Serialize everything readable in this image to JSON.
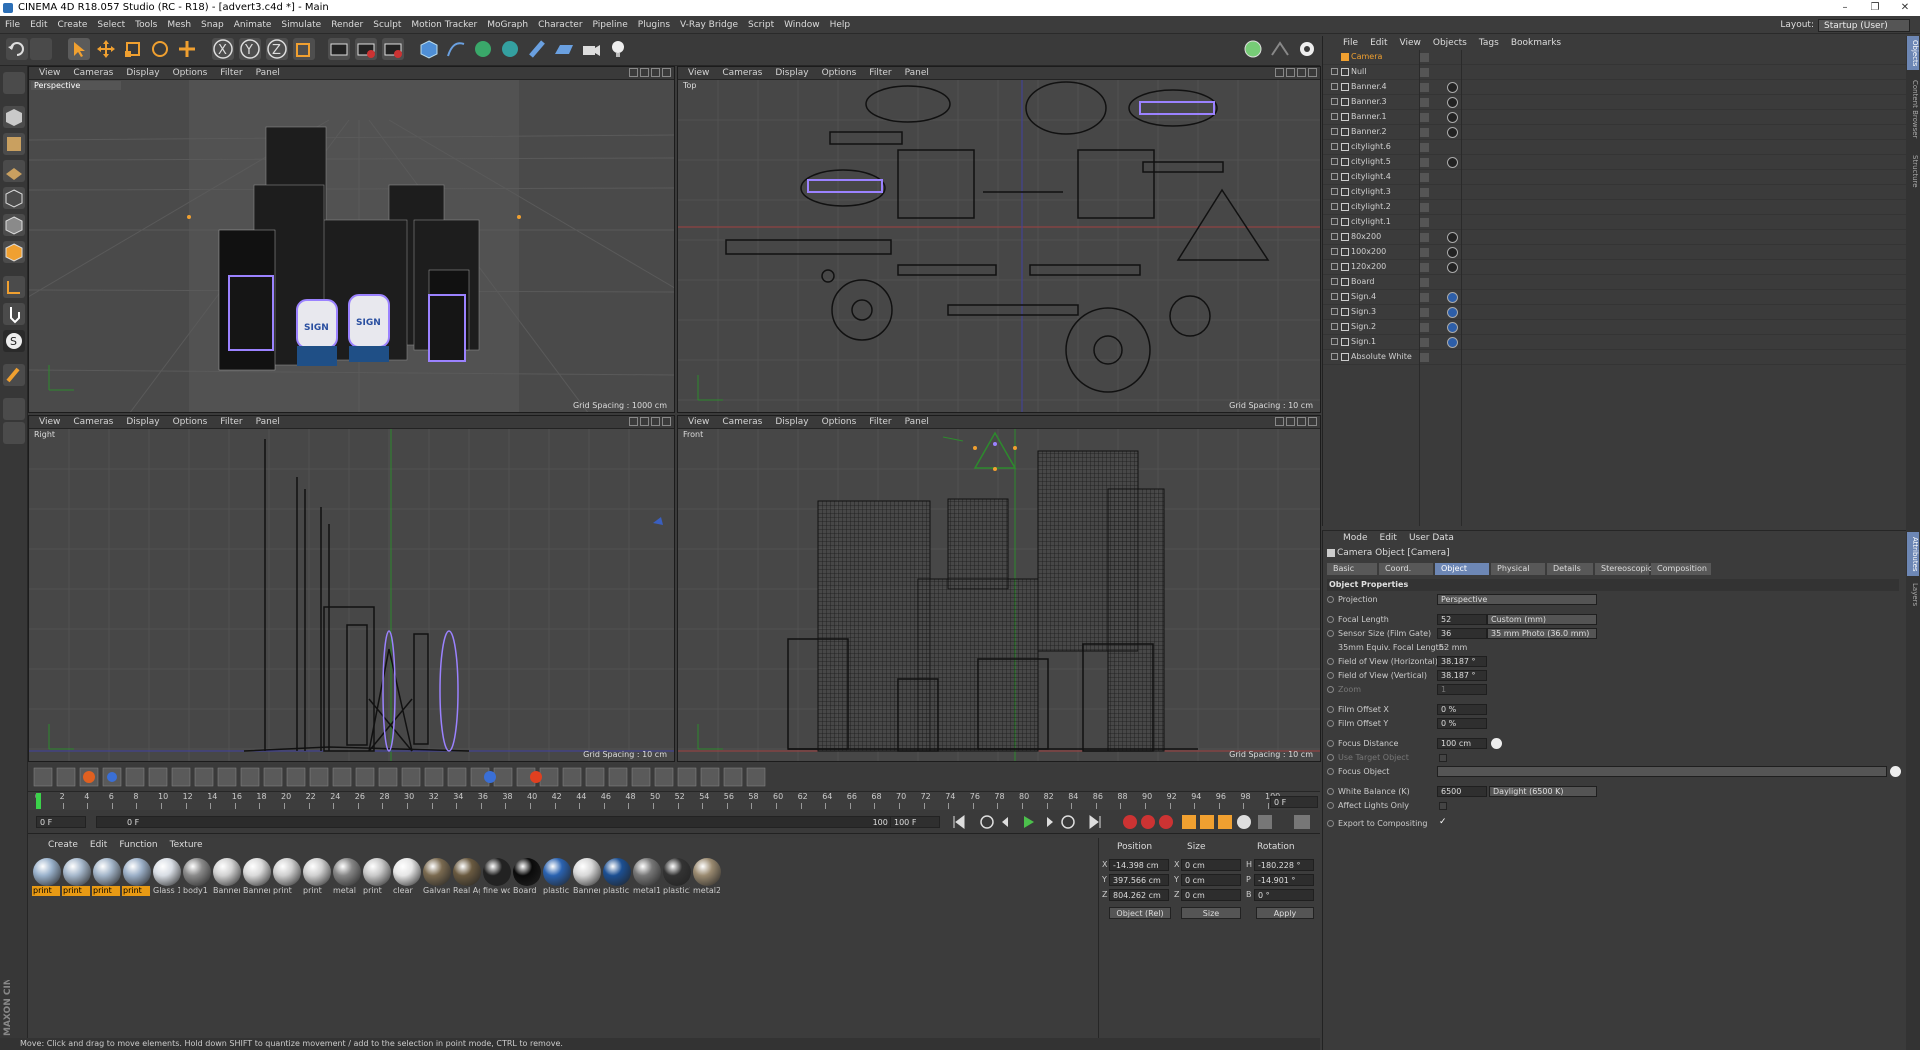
{
  "window": {
    "title": "CINEMA 4D R18.057 Studio (RC - R18) - [advert3.c4d *] - Main",
    "controls": [
      "–",
      "❐",
      "✕"
    ]
  },
  "menu": [
    "File",
    "Edit",
    "Create",
    "Select",
    "Tools",
    "Mesh",
    "Snap",
    "Animate",
    "Simulate",
    "Render",
    "Sculpt",
    "Motion Tracker",
    "MoGraph",
    "Character",
    "Pipeline",
    "Plugins",
    "V-Ray Bridge",
    "Script",
    "Window",
    "Help"
  ],
  "layout": {
    "label": "Layout:",
    "value": "Startup (User)"
  },
  "viewport_menu": [
    "View",
    "Cameras",
    "Display",
    "Options",
    "Filter",
    "Panel"
  ],
  "viewports": [
    {
      "name": "Perspective",
      "grid": "Grid Spacing : 1000 cm"
    },
    {
      "name": "Top",
      "grid": "Grid Spacing : 10 cm"
    },
    {
      "name": "Right",
      "grid": "Grid Spacing : 10 cm"
    },
    {
      "name": "Front",
      "grid": "Grid Spacing : 10 cm"
    }
  ],
  "sign_text": "SIGN",
  "timeline": {
    "ticks": [
      "0",
      "2",
      "4",
      "6",
      "8",
      "10",
      "12",
      "14",
      "16",
      "18",
      "20",
      "22",
      "24",
      "26",
      "28",
      "30",
      "32",
      "34",
      "36",
      "38",
      "40",
      "42",
      "44",
      "46",
      "48",
      "50",
      "52",
      "54",
      "56",
      "58",
      "60",
      "62",
      "64",
      "66",
      "68",
      "70",
      "72",
      "74",
      "76",
      "78",
      "80",
      "82",
      "84",
      "86",
      "88",
      "90",
      "92",
      "94",
      "96",
      "98",
      "100"
    ],
    "current": "0 F",
    "start": "0 F",
    "end": "100 F",
    "end2": "100 F",
    "slider_start": "0 F",
    "slider_end": "100 F"
  },
  "materials": {
    "menu": [
      "Create",
      "Edit",
      "Function",
      "Texture"
    ],
    "items": [
      {
        "label": "print",
        "hl": true
      },
      {
        "label": "print",
        "hl": true
      },
      {
        "label": "print",
        "hl": true
      },
      {
        "label": "print",
        "hl": true
      },
      {
        "label": "Glass 1",
        "hl": false
      },
      {
        "label": "body1",
        "hl": false
      },
      {
        "label": "Banner",
        "hl": false
      },
      {
        "label": "Banner",
        "hl": false
      },
      {
        "label": "print",
        "hl": false
      },
      {
        "label": "print",
        "hl": false
      },
      {
        "label": "metal",
        "hl": false
      },
      {
        "label": "print",
        "hl": false
      },
      {
        "label": "clear",
        "hl": false
      },
      {
        "label": "Galvanu",
        "hl": false
      },
      {
        "label": "Real Ag",
        "hl": false
      },
      {
        "label": "fine wo",
        "hl": false
      },
      {
        "label": "Board",
        "hl": false
      },
      {
        "label": "plastic1",
        "hl": false
      },
      {
        "label": "Banner",
        "hl": false
      },
      {
        "label": "plastic1",
        "hl": false
      },
      {
        "label": "metal1",
        "hl": false
      },
      {
        "label": "plastic2",
        "hl": false
      },
      {
        "label": "metal2",
        "hl": false
      }
    ]
  },
  "coordinates": {
    "headers": [
      "Position",
      "Size",
      "Rotation"
    ],
    "axes": [
      "X",
      "Y",
      "Z"
    ],
    "size_axes": [
      "X",
      "Y",
      "Z"
    ],
    "rot_axes": [
      "H",
      "P",
      "B"
    ],
    "position": [
      "-14.398 cm",
      "397.566 cm",
      "804.262 cm"
    ],
    "size": [
      "0 cm",
      "0 cm",
      "0 cm"
    ],
    "rotation": [
      "-180.228 °",
      "-14.901 °",
      "0 °"
    ],
    "mode": "Object (Rel)",
    "size_mode": "Size",
    "apply": "Apply"
  },
  "status": "Move: Click and drag to move elements. Hold down SHIFT to quantize movement / add to the selection in point mode, CTRL to remove.",
  "maxon": "MAXON CINEMA 4D",
  "objects": {
    "menu": [
      "File",
      "Edit",
      "View",
      "Objects",
      "Tags",
      "Bookmarks"
    ],
    "rows": [
      {
        "name": "Camera",
        "cam": true,
        "tag": "none"
      },
      {
        "name": "Null",
        "tag": "none"
      },
      {
        "name": "Banner.4",
        "tag": "tex"
      },
      {
        "name": "Banner.3",
        "tag": "tex"
      },
      {
        "name": "Banner.1",
        "tag": "tex"
      },
      {
        "name": "Banner.2",
        "tag": "tex"
      },
      {
        "name": "citylight.6",
        "tag": "none"
      },
      {
        "name": "citylight.5",
        "tag": "tex"
      },
      {
        "name": "citylight.4",
        "tag": "none"
      },
      {
        "name": "citylight.3",
        "tag": "none"
      },
      {
        "name": "citylight.2",
        "tag": "none"
      },
      {
        "name": "citylight.1",
        "tag": "none"
      },
      {
        "name": "80x200",
        "tag": "tex"
      },
      {
        "name": "100x200",
        "tag": "tex"
      },
      {
        "name": "120x200",
        "tag": "tex"
      },
      {
        "name": "Board",
        "tag": "none"
      },
      {
        "name": "Sign.4",
        "tag": "blue"
      },
      {
        "name": "Sign.3",
        "tag": "blue"
      },
      {
        "name": "Sign.2",
        "tag": "blue"
      },
      {
        "name": "Sign.1",
        "tag": "blue"
      },
      {
        "name": "Absolute White",
        "tag": "none"
      }
    ]
  },
  "attributes": {
    "menu": [
      "Mode",
      "Edit",
      "User Data"
    ],
    "title": "Camera Object [Camera]",
    "tabs": [
      "Basic",
      "Coord.",
      "Object",
      "Physical",
      "Details",
      "Stereoscopic",
      "Composition"
    ],
    "active_tab": "Object",
    "section": "Object Properties",
    "projection": {
      "label": "Projection",
      "value": "Perspective"
    },
    "focal_length": {
      "label": "Focal Length",
      "value": "52",
      "preset": "Custom (mm)"
    },
    "sensor": {
      "label": "Sensor Size (Film Gate)",
      "value": "36",
      "preset": "35 mm Photo (36.0 mm)"
    },
    "equiv": {
      "label": "35mm Equiv. Focal Length:",
      "value": "52 mm"
    },
    "fov_h": {
      "label": "Field of View (Horizontal)",
      "value": "38.187 °"
    },
    "fov_v": {
      "label": "Field of View (Vertical)",
      "value": "38.187 °"
    },
    "zoom": {
      "label": "Zoom",
      "value": "1"
    },
    "film_x": {
      "label": "Film Offset X",
      "value": "0 %"
    },
    "film_y": {
      "label": "Film Offset Y",
      "value": "0 %"
    },
    "focus_dist": {
      "label": "Focus Distance",
      "value": "100 cm"
    },
    "use_target": {
      "label": "Use Target Object"
    },
    "focus_obj": {
      "label": "Focus Object"
    },
    "wb": {
      "label": "White Balance (K)",
      "value": "6500",
      "preset": "Daylight (6500 K)"
    },
    "affect": {
      "label": "Affect Lights Only"
    },
    "export": {
      "label": "Export to Compositing",
      "value": "✓"
    }
  },
  "right_tabs": [
    "Objects",
    "Content Browser",
    "Structure"
  ],
  "attr_tabs": [
    "Attributes",
    "Layers"
  ]
}
